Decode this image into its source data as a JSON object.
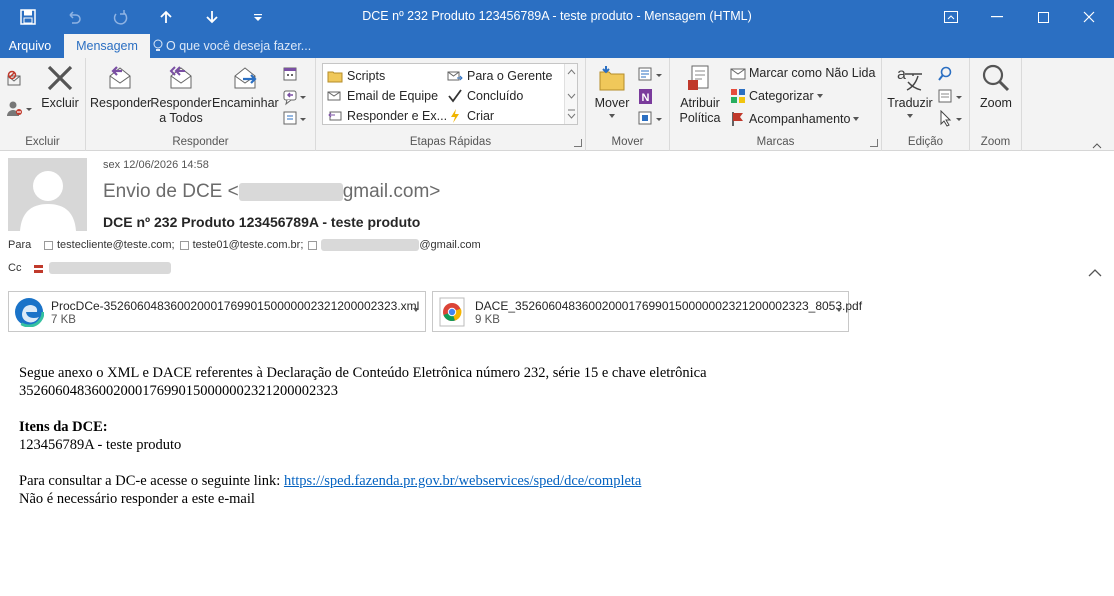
{
  "window": {
    "title": "DCE nº 232 Produto 123456789A - teste produto  -  Mensagem (HTML)"
  },
  "tabs": [
    {
      "label": "Arquivo"
    },
    {
      "label": "Mensagem"
    }
  ],
  "tell_me": "O que você deseja fazer...",
  "ribbon": {
    "excluir_group": {
      "label": "Excluir",
      "delete_button": "Excluir"
    },
    "responder_group": {
      "label": "Responder",
      "reply": "Responder",
      "reply_all_line1": "Responder",
      "reply_all_line2": "a Todos",
      "forward": "Encaminhar"
    },
    "quick_steps": {
      "label": "Etapas Rápidas",
      "items": [
        "Scripts",
        "Para o Gerente",
        "Email de Equipe",
        "Concluído",
        "Responder e Ex...",
        "Criar"
      ]
    },
    "mover_group": {
      "label": "Mover",
      "move_button": "Mover"
    },
    "marcas_group": {
      "label": "Marcas",
      "policy_line1": "Atribuir",
      "policy_line2": "Política",
      "mark_unread": "Marcar como Não Lida",
      "categorize": "Categorizar",
      "follow_up": "Acompanhamento"
    },
    "edicao_group": {
      "label": "Edição",
      "translate": "Traduzir"
    },
    "zoom_group": {
      "label": "Zoom",
      "zoom": "Zoom"
    }
  },
  "message": {
    "date": "sex 12/06/2026 14:58",
    "from_prefix": "Envio de DCE <",
    "from_suffix": "gmail.com>",
    "subject": "DCE nº 232 Produto 123456789A - teste produto",
    "to_label": "Para",
    "to_recipients": [
      "testecliente@teste.com;",
      "teste01@teste.com.br;",
      "@gmail.com"
    ],
    "cc_label": "Cc"
  },
  "attachments": [
    {
      "name": "ProcDCe-35260604836002000176990150000002321200002323.xml",
      "size": "7 KB",
      "icon": "edge-icon"
    },
    {
      "name": "DACE_35260604836002000176990150000002321200002323_8053.pdf",
      "size": "9 KB",
      "icon": "chrome-icon"
    }
  ],
  "body": {
    "line1": "Segue anexo o XML e DACE referentes à Declaração de Conteúdo Eletrônica número 232, série 15 e chave eletrônica",
    "line2": "35260604836002000176990150000002321200002323",
    "items_heading": "Itens da DCE:",
    "item1": "123456789A - teste produto",
    "link_prefix": "Para consultar a DC-e acesse o seguinte link: ",
    "link_url": "https://sped.fazenda.pr.gov.br/webservices/sped/dce/completa",
    "no_reply": "Não é necessário responder a este e-mail"
  },
  "colors": {
    "titlebar": "#2b6fc2",
    "ribbon": "#f3f3f3",
    "link": "#0563c1"
  }
}
